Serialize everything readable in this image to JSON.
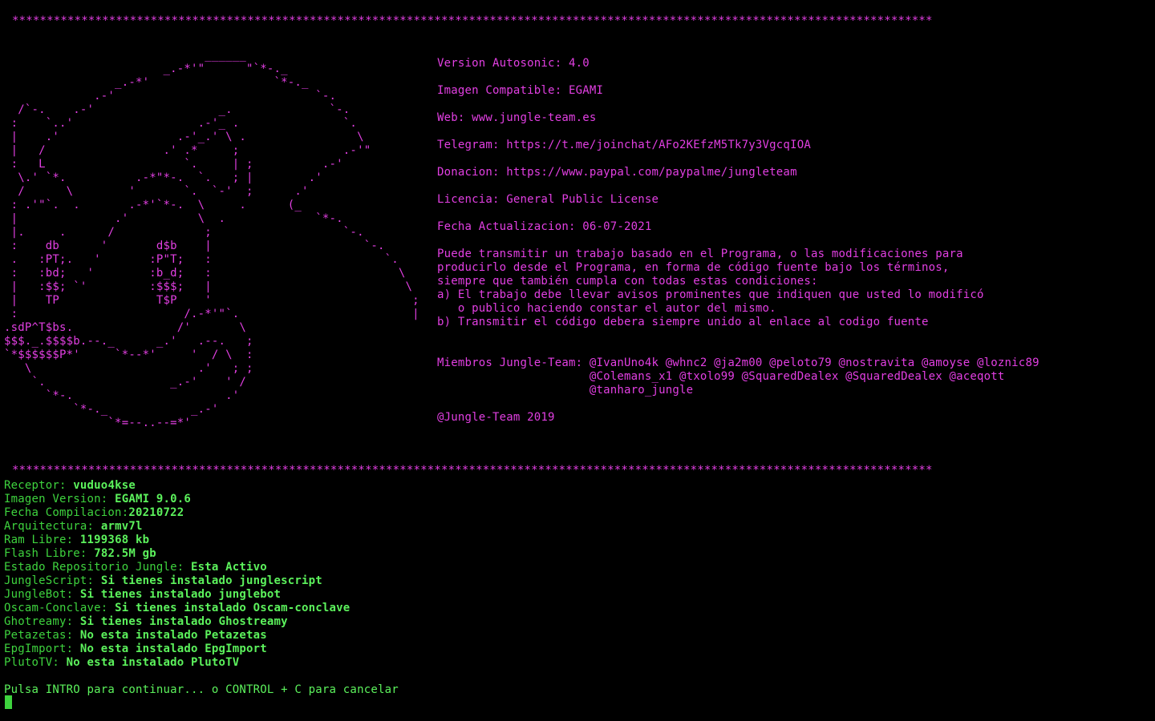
{
  "colors": {
    "background": "#000000",
    "magenta": "#e23fe2",
    "green_label": "#3ed33e",
    "green_value": "#5cf25c",
    "cursor": "#3ed33e"
  },
  "header": {
    "separator_top": "*************************************************************************************************************************************",
    "separator_bottom": "*************************************************************************************************************************************"
  },
  "ascii_art": [
    "                             ______",
    "                       _.-*'\"      \"`*-._",
    "                _.-*'                  `*-._",
    "             .-'                             `-.",
    "  /`-.    .-'                  _.              `-.",
    " :    `..'                  .-'_ .               `.",
    " |    .'                 .-'_.' \\ .                \\",
    " |   /                 .' .*     ;               .-'\"",
    " :   L                    `.     | ;          .-'",
    "  \\.' `*.          .-*\"*-.  `.   ; |        .'",
    "  /      \\        '       `.  `-'  ;      .'",
    " : .'\"`.  .       .-*'`*-.  \\     .      (_",
    " |              .'          \\  .             `*-.",
    " |.     .      /             ;                   `-.",
    " :    db      '       d$b    |                      `-.",
    " .   :PT;.   '       :P\"T;   :                         `.",
    " :   :bd;   '        :b_d;   :                           \\",
    " |   :$$; `'         :$$$;   |                            \\",
    " |    TP              T$P    '                             ;",
    " :                        /.-*'\"`.                         |",
    ".sdP^T$bs.               /'       \\",
    "$$$._.$$$$b.--._      _.'   .--.   ;",
    "`*$$$$$$P*'     `*--*'     '  / \\  :",
    "   \\                        .'   ; ;",
    "    `.                  _.-'    ' /",
    "      `*-.                      .'",
    "          `*-._            _.-'",
    "               `*=--..--=*'"
  ],
  "info": {
    "version": "Version Autosonic: 4.0",
    "image_compat": "Imagen Compatible: EGAMI",
    "web": "Web: www.jungle-team.es",
    "telegram": "Telegram: https://t.me/joinchat/AFo2KEfzM5Tk7y3VgcqIOA",
    "donacion": "Donacion: https://www.paypal.com/paypalme/jungleteam",
    "licencia": "Licencia: General Public License",
    "fecha": "Fecha Actualizacion: 06-07-2021",
    "license_text": [
      "Puede transmitir un trabajo basado en el Programa, o las modificaciones para",
      "producirlo desde el Programa, en forma de código fuente bajo los términos,",
      "siempre que también cumpla con todas estas condiciones:",
      "a) El trabajo debe llevar avisos prominentes que indiquen que usted lo modificó",
      "   o publico haciendo constar el autor del mismo.",
      "b) Transmitir el código debera siempre unido al enlace al codigo fuente"
    ],
    "members": [
      "Miembros Jungle-Team: @IvanUno4k @whnc2 @ja2m00 @peloto79 @nostravita @amoyse @loznic89",
      "                      @Colemans_x1 @txolo99 @SquaredDealex @SquaredDealex @aceqott",
      "                      @tanharo_jungle"
    ],
    "copyright": "@Jungle-Team 2019"
  },
  "system": [
    {
      "label": "Receptor: ",
      "value": "vuduo4kse"
    },
    {
      "label": "Imagen Version: ",
      "value": "EGAMI 9.0.6"
    },
    {
      "label": "Fecha Compilacion:",
      "value": "20210722"
    },
    {
      "label": "Arquitectura: ",
      "value": "armv7l"
    },
    {
      "label": "Ram Libre: ",
      "value": "1199368 kb"
    },
    {
      "label": "Flash Libre: ",
      "value": "782.5M gb"
    },
    {
      "label": "Estado Repositorio Jungle: ",
      "value": "Esta Activo"
    },
    {
      "label": "JungleScript: ",
      "value": "Si tienes instalado junglescript"
    },
    {
      "label": "JungleBot: ",
      "value": "Si tienes instalado junglebot"
    },
    {
      "label": "Oscam-Conclave: ",
      "value": "Si tienes instalado Oscam-conclave"
    },
    {
      "label": "Ghotreamy: ",
      "value": "Si tienes instalado Ghostreamy"
    },
    {
      "label": "Petazetas: ",
      "value": "No esta instalado Petazetas"
    },
    {
      "label": "EpgImport: ",
      "value": "No esta instalado EpgImport"
    },
    {
      "label": "PlutoTV: ",
      "value": "No esta instalado PlutoTV"
    }
  ],
  "prompt": "Pulsa INTRO para continuar... o CONTROL + C para cancelar"
}
